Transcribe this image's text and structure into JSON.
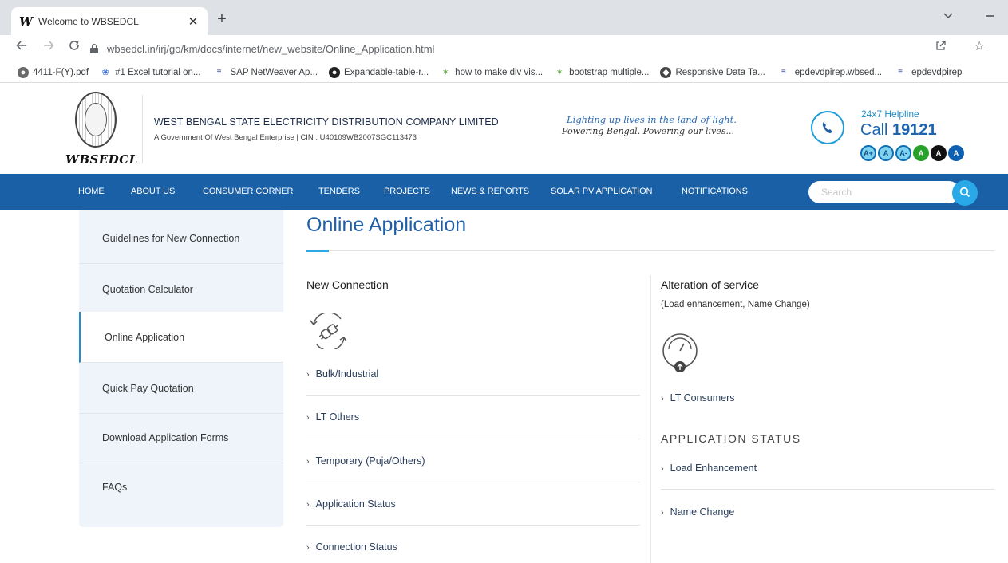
{
  "browser": {
    "tab": {
      "title": "Welcome to WBSEDCL",
      "favicon": "W",
      "close": "✕"
    },
    "new_tab": "+",
    "url": "wbsedcl.in/irj/go/km/docs/internet/new_website/Online_Application.html",
    "bookmarks": [
      {
        "icon": "globe-icon",
        "label": "4411-F(Y).pdf"
      },
      {
        "icon": "excel-tutorial-icon",
        "label": "#1 Excel tutorial on..."
      },
      {
        "icon": "sap-icon",
        "label": "SAP NetWeaver Ap..."
      },
      {
        "icon": "github-icon",
        "label": "Expandable-table-r..."
      },
      {
        "icon": "stackoverflow-icon",
        "label": "how to make div vis..."
      },
      {
        "icon": "stackoverflow-icon",
        "label": "bootstrap multiple..."
      },
      {
        "icon": "codepen-icon",
        "label": "Responsive Data Ta..."
      },
      {
        "icon": "sap-icon",
        "label": "epdevdpirep.wbsed..."
      },
      {
        "icon": "sap-icon",
        "label": "epdevdpirep"
      }
    ]
  },
  "header": {
    "logo_text": "WBSEDCL",
    "company_name": "WEST BENGAL STATE ELECTRICITY DISTRIBUTION COMPANY LIMITED",
    "company_sub": "A Government Of West Bengal Enterprise | CIN : U40109WB2007SGC113473",
    "tagline_1": "Lighting up lives in the land of light.",
    "tagline_2": "Powering Bengal. Powering our lives...",
    "helpline_label": "24x7 Helpline",
    "helpline_prefix": "Call",
    "helpline_number": "19121",
    "a11y": {
      "increase": "A+",
      "normal": "A",
      "decrease": "A-",
      "green": "A",
      "black": "A",
      "blue": "A"
    }
  },
  "nav": {
    "items": [
      "HOME",
      "ABOUT US",
      "CONSUMER CORNER",
      "TENDERS",
      "PROJECTS",
      "NEWS & REPORTS",
      "SOLAR PV APPLICATION",
      "NOTIFICATIONS"
    ],
    "search_placeholder": "Search"
  },
  "sidebar": {
    "items": [
      {
        "label": "Guidelines for New Connection",
        "active": false
      },
      {
        "label": "Quotation Calculator",
        "active": false
      },
      {
        "label": "Online Application",
        "active": true
      },
      {
        "label": "Quick Pay Quotation",
        "active": false
      },
      {
        "label": "Download Application Forms",
        "active": false
      },
      {
        "label": "FAQs",
        "active": false
      }
    ]
  },
  "main": {
    "title": "Online Application",
    "new_connection": {
      "heading": "New Connection",
      "links": [
        "Bulk/Industrial",
        "LT Others",
        "Temporary (Puja/Others)",
        "Application Status",
        "Connection Status"
      ]
    },
    "alteration": {
      "heading": "Alteration of service",
      "subheading": "(Load enhancement, Name Change)",
      "links": [
        "LT Consumers"
      ]
    },
    "application_status": {
      "heading": "APPLICATION STATUS",
      "links": [
        "Load Enhancement",
        "Name Change"
      ]
    },
    "chevron": "›"
  },
  "colors": {
    "nav_bg": "#1960a7",
    "accent": "#29a9e7",
    "title": "#1f5fa8",
    "sidebar_bg": "#eef4fa"
  }
}
